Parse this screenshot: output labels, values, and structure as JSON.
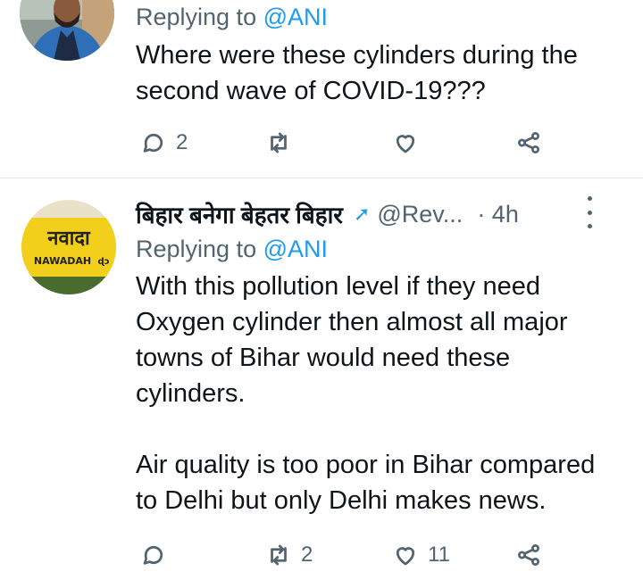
{
  "tweets": [
    {
      "replying_to_prefix": "Replying to ",
      "replying_to_mention": "@ANI",
      "text": "Where were these cylinders during the\nsecond wave of COVID-19???",
      "actions": {
        "reply_count": "2",
        "retweet_count": "",
        "like_count": ""
      }
    },
    {
      "display_name": "बिहार बनेगा बेहतर बिहार",
      "badge": "➚",
      "handle": "@Rev...",
      "time": "· 4h",
      "replying_to_prefix": "Replying to ",
      "replying_to_mention": "@ANI",
      "avatar_text_hindi": "नवादा",
      "avatar_text_english": "NAWADAH",
      "text": "With this pollution level if they need\nOxygen cylinder then almost all major\ntowns of Bihar would need these\ncylinders.\n\nAir quality is too poor in Bihar compared\nto Delhi but only Delhi makes news.",
      "actions": {
        "reply_count": "",
        "retweet_count": "2",
        "like_count": "11"
      }
    }
  ],
  "colors": {
    "accent": "#1d9bf0",
    "muted": "#536471",
    "text": "#0f1419",
    "divider": "#e1e8ed"
  }
}
